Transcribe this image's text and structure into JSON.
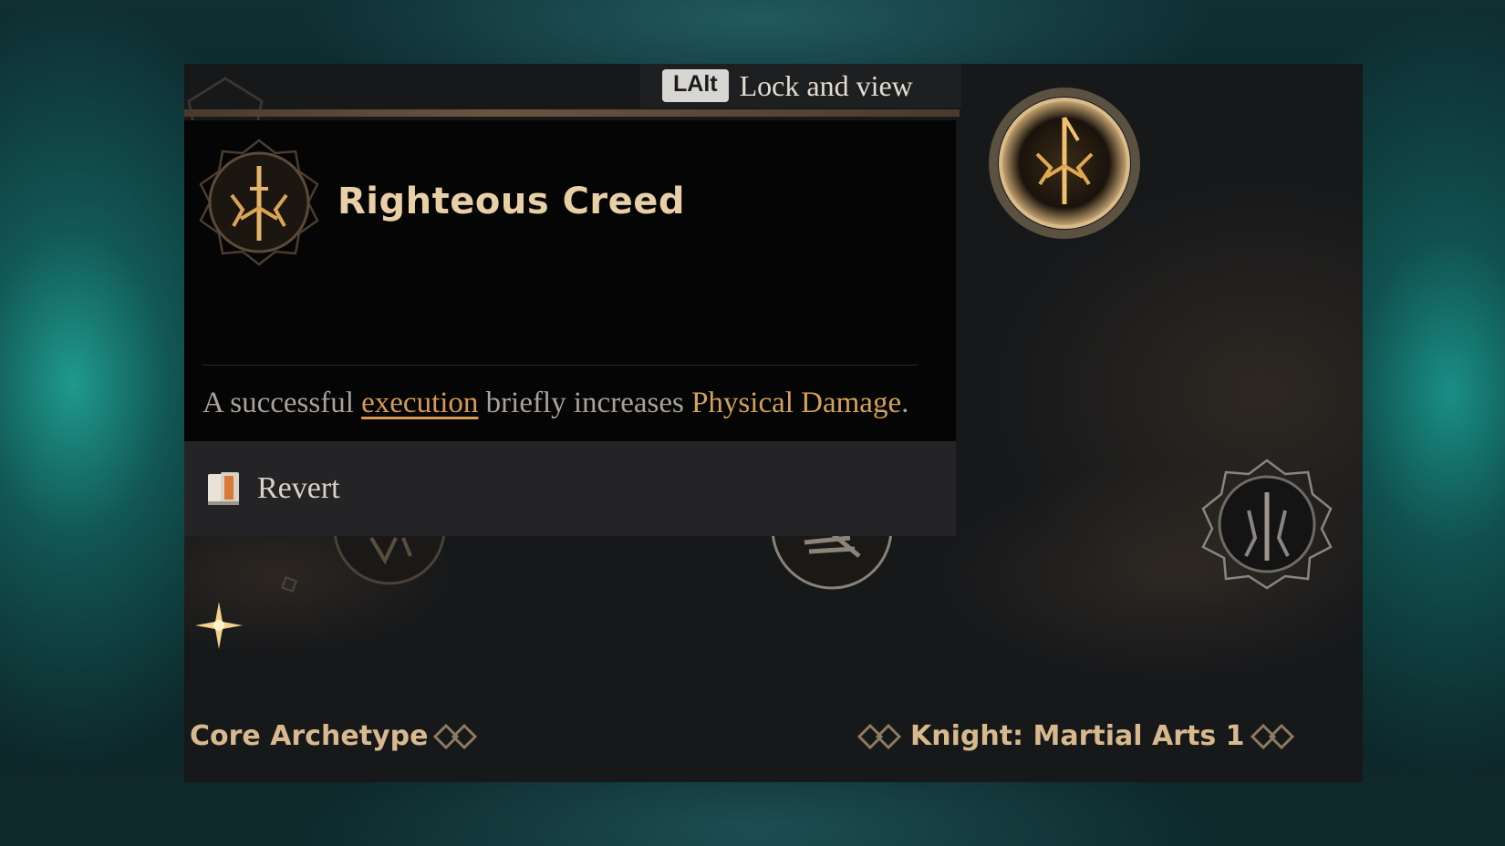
{
  "hint": {
    "key": "LAlt",
    "label": "Lock and view"
  },
  "tooltip": {
    "title": "Righteous Creed",
    "desc_prefix": "A successful ",
    "desc_link": "execution",
    "desc_middle": " briefly increases ",
    "desc_keyword": "Physical Damage",
    "desc_suffix": "."
  },
  "revert": {
    "label": "Revert"
  },
  "footer": {
    "left_label": "Core Archetype",
    "right_label": "Knight: Martial Arts 1"
  },
  "colors": {
    "accent_gold": "#d3a259",
    "title_gold": "#e8cfa6",
    "link_orange": "#d89a55",
    "teal_bg": "#1f9a8e"
  },
  "icons": [
    "righteous-creed-skill-icon",
    "selected-skill-node-icon",
    "locked-skill-node-icon",
    "diamond-ornament-icon",
    "revert-book-icon",
    "sparkle-icon"
  ]
}
